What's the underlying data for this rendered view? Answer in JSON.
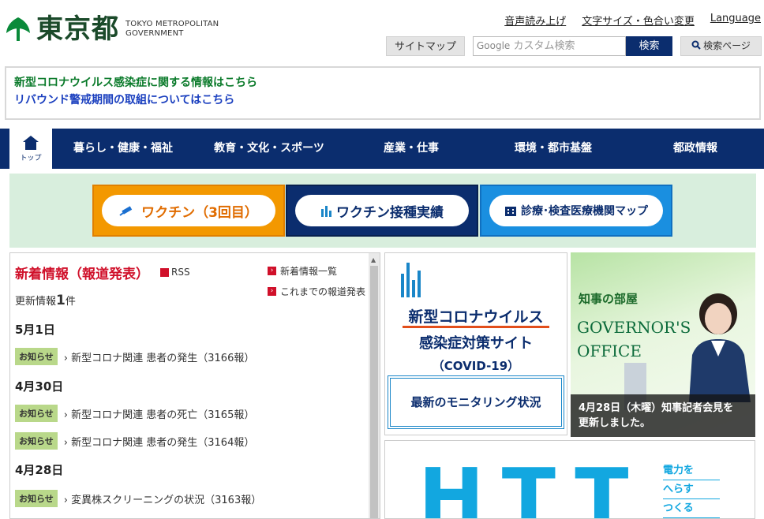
{
  "header": {
    "logo_jp": "東京都",
    "logo_en_line1": "TOKYO METROPOLITAN",
    "logo_en_line2": "GOVERNMENT",
    "util_links": [
      "音声読み上げ",
      "文字サイズ・色合い変更",
      "Language"
    ],
    "sitemap": "サイトマップ",
    "search_google": "Google",
    "search_placeholder": "カスタム検索",
    "search_button": "検索",
    "search_page": "検索ページ"
  },
  "notice": {
    "line1": "新型コロナウイルス感染症に関する情報はこちら",
    "line2": "リバウンド警戒期間の取組についてはこちら"
  },
  "nav": {
    "home": "トップ",
    "items": [
      "暮らし・健康・福祉",
      "教育・文化・スポーツ",
      "産業・仕事",
      "環境・都市基盤",
      "都政情報"
    ]
  },
  "banners": {
    "vaccine3": "ワクチン（3回目）",
    "vaccine_record": "ワクチン接種実績",
    "clinic_map": "診療･検査医療機関マップ"
  },
  "news": {
    "title": "新着情報（報道発表）",
    "rss": "RSS",
    "link1": "新着情報一覧",
    "link2": "これまでの報道発表",
    "updated_label": "更新情報",
    "updated_count": "1",
    "updated_unit": "件",
    "badge": "お知らせ",
    "groups": [
      {
        "date": "5月1日",
        "items": [
          "新型コロナ関連 患者の発生（3166報）"
        ]
      },
      {
        "date": "4月30日",
        "items": [
          "新型コロナ関連 患者の死亡（3165報）",
          "新型コロナ関連 患者の発生（3164報）"
        ]
      },
      {
        "date": "4月28日",
        "items": [
          "変異株スクリーニングの状況（3163報）"
        ]
      }
    ]
  },
  "covid_tile": {
    "line1": "新型コロナウイルス",
    "line2": "感染症対策サイト",
    "line3": "（COVID-19）",
    "box": "最新のモニタリング状況"
  },
  "governor_tile": {
    "room": "知事の部屋",
    "title_line1": "GOVERNOR'S",
    "title_line2": "OFFICE",
    "caption_line1": "4月28日（木曜）知事記者会見を",
    "caption_line2": "更新しました。"
  },
  "bottom_tile": {
    "big": "HTT",
    "side": [
      "電力を",
      "へらす",
      "つくる"
    ]
  },
  "colors": {
    "navy": "#0b2d6e",
    "green_logo": "#0a8a3a",
    "red_accent": "#d0102a",
    "orange": "#f39800",
    "blue": "#1a8fe0"
  }
}
